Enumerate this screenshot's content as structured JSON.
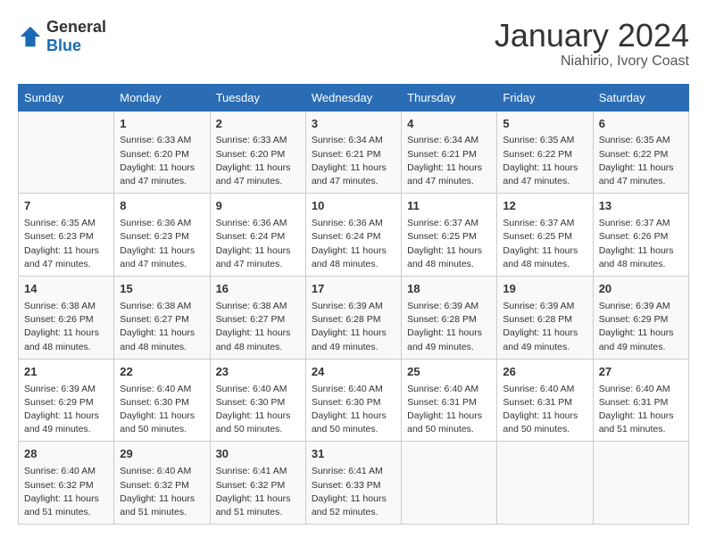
{
  "header": {
    "logo_general": "General",
    "logo_blue": "Blue",
    "month": "January 2024",
    "location": "Niahirio, Ivory Coast"
  },
  "weekdays": [
    "Sunday",
    "Monday",
    "Tuesday",
    "Wednesday",
    "Thursday",
    "Friday",
    "Saturday"
  ],
  "weeks": [
    [
      {
        "day": "",
        "info": ""
      },
      {
        "day": "1",
        "info": "Sunrise: 6:33 AM\nSunset: 6:20 PM\nDaylight: 11 hours and 47 minutes."
      },
      {
        "day": "2",
        "info": "Sunrise: 6:33 AM\nSunset: 6:20 PM\nDaylight: 11 hours and 47 minutes."
      },
      {
        "day": "3",
        "info": "Sunrise: 6:34 AM\nSunset: 6:21 PM\nDaylight: 11 hours and 47 minutes."
      },
      {
        "day": "4",
        "info": "Sunrise: 6:34 AM\nSunset: 6:21 PM\nDaylight: 11 hours and 47 minutes."
      },
      {
        "day": "5",
        "info": "Sunrise: 6:35 AM\nSunset: 6:22 PM\nDaylight: 11 hours and 47 minutes."
      },
      {
        "day": "6",
        "info": "Sunrise: 6:35 AM\nSunset: 6:22 PM\nDaylight: 11 hours and 47 minutes."
      }
    ],
    [
      {
        "day": "7",
        "info": "Sunrise: 6:35 AM\nSunset: 6:23 PM\nDaylight: 11 hours and 47 minutes."
      },
      {
        "day": "8",
        "info": "Sunrise: 6:36 AM\nSunset: 6:23 PM\nDaylight: 11 hours and 47 minutes."
      },
      {
        "day": "9",
        "info": "Sunrise: 6:36 AM\nSunset: 6:24 PM\nDaylight: 11 hours and 47 minutes."
      },
      {
        "day": "10",
        "info": "Sunrise: 6:36 AM\nSunset: 6:24 PM\nDaylight: 11 hours and 48 minutes."
      },
      {
        "day": "11",
        "info": "Sunrise: 6:37 AM\nSunset: 6:25 PM\nDaylight: 11 hours and 48 minutes."
      },
      {
        "day": "12",
        "info": "Sunrise: 6:37 AM\nSunset: 6:25 PM\nDaylight: 11 hours and 48 minutes."
      },
      {
        "day": "13",
        "info": "Sunrise: 6:37 AM\nSunset: 6:26 PM\nDaylight: 11 hours and 48 minutes."
      }
    ],
    [
      {
        "day": "14",
        "info": "Sunrise: 6:38 AM\nSunset: 6:26 PM\nDaylight: 11 hours and 48 minutes."
      },
      {
        "day": "15",
        "info": "Sunrise: 6:38 AM\nSunset: 6:27 PM\nDaylight: 11 hours and 48 minutes."
      },
      {
        "day": "16",
        "info": "Sunrise: 6:38 AM\nSunset: 6:27 PM\nDaylight: 11 hours and 48 minutes."
      },
      {
        "day": "17",
        "info": "Sunrise: 6:39 AM\nSunset: 6:28 PM\nDaylight: 11 hours and 49 minutes."
      },
      {
        "day": "18",
        "info": "Sunrise: 6:39 AM\nSunset: 6:28 PM\nDaylight: 11 hours and 49 minutes."
      },
      {
        "day": "19",
        "info": "Sunrise: 6:39 AM\nSunset: 6:28 PM\nDaylight: 11 hours and 49 minutes."
      },
      {
        "day": "20",
        "info": "Sunrise: 6:39 AM\nSunset: 6:29 PM\nDaylight: 11 hours and 49 minutes."
      }
    ],
    [
      {
        "day": "21",
        "info": "Sunrise: 6:39 AM\nSunset: 6:29 PM\nDaylight: 11 hours and 49 minutes."
      },
      {
        "day": "22",
        "info": "Sunrise: 6:40 AM\nSunset: 6:30 PM\nDaylight: 11 hours and 50 minutes."
      },
      {
        "day": "23",
        "info": "Sunrise: 6:40 AM\nSunset: 6:30 PM\nDaylight: 11 hours and 50 minutes."
      },
      {
        "day": "24",
        "info": "Sunrise: 6:40 AM\nSunset: 6:30 PM\nDaylight: 11 hours and 50 minutes."
      },
      {
        "day": "25",
        "info": "Sunrise: 6:40 AM\nSunset: 6:31 PM\nDaylight: 11 hours and 50 minutes."
      },
      {
        "day": "26",
        "info": "Sunrise: 6:40 AM\nSunset: 6:31 PM\nDaylight: 11 hours and 50 minutes."
      },
      {
        "day": "27",
        "info": "Sunrise: 6:40 AM\nSunset: 6:31 PM\nDaylight: 11 hours and 51 minutes."
      }
    ],
    [
      {
        "day": "28",
        "info": "Sunrise: 6:40 AM\nSunset: 6:32 PM\nDaylight: 11 hours and 51 minutes."
      },
      {
        "day": "29",
        "info": "Sunrise: 6:40 AM\nSunset: 6:32 PM\nDaylight: 11 hours and 51 minutes."
      },
      {
        "day": "30",
        "info": "Sunrise: 6:41 AM\nSunset: 6:32 PM\nDaylight: 11 hours and 51 minutes."
      },
      {
        "day": "31",
        "info": "Sunrise: 6:41 AM\nSunset: 6:33 PM\nDaylight: 11 hours and 52 minutes."
      },
      {
        "day": "",
        "info": ""
      },
      {
        "day": "",
        "info": ""
      },
      {
        "day": "",
        "info": ""
      }
    ]
  ]
}
